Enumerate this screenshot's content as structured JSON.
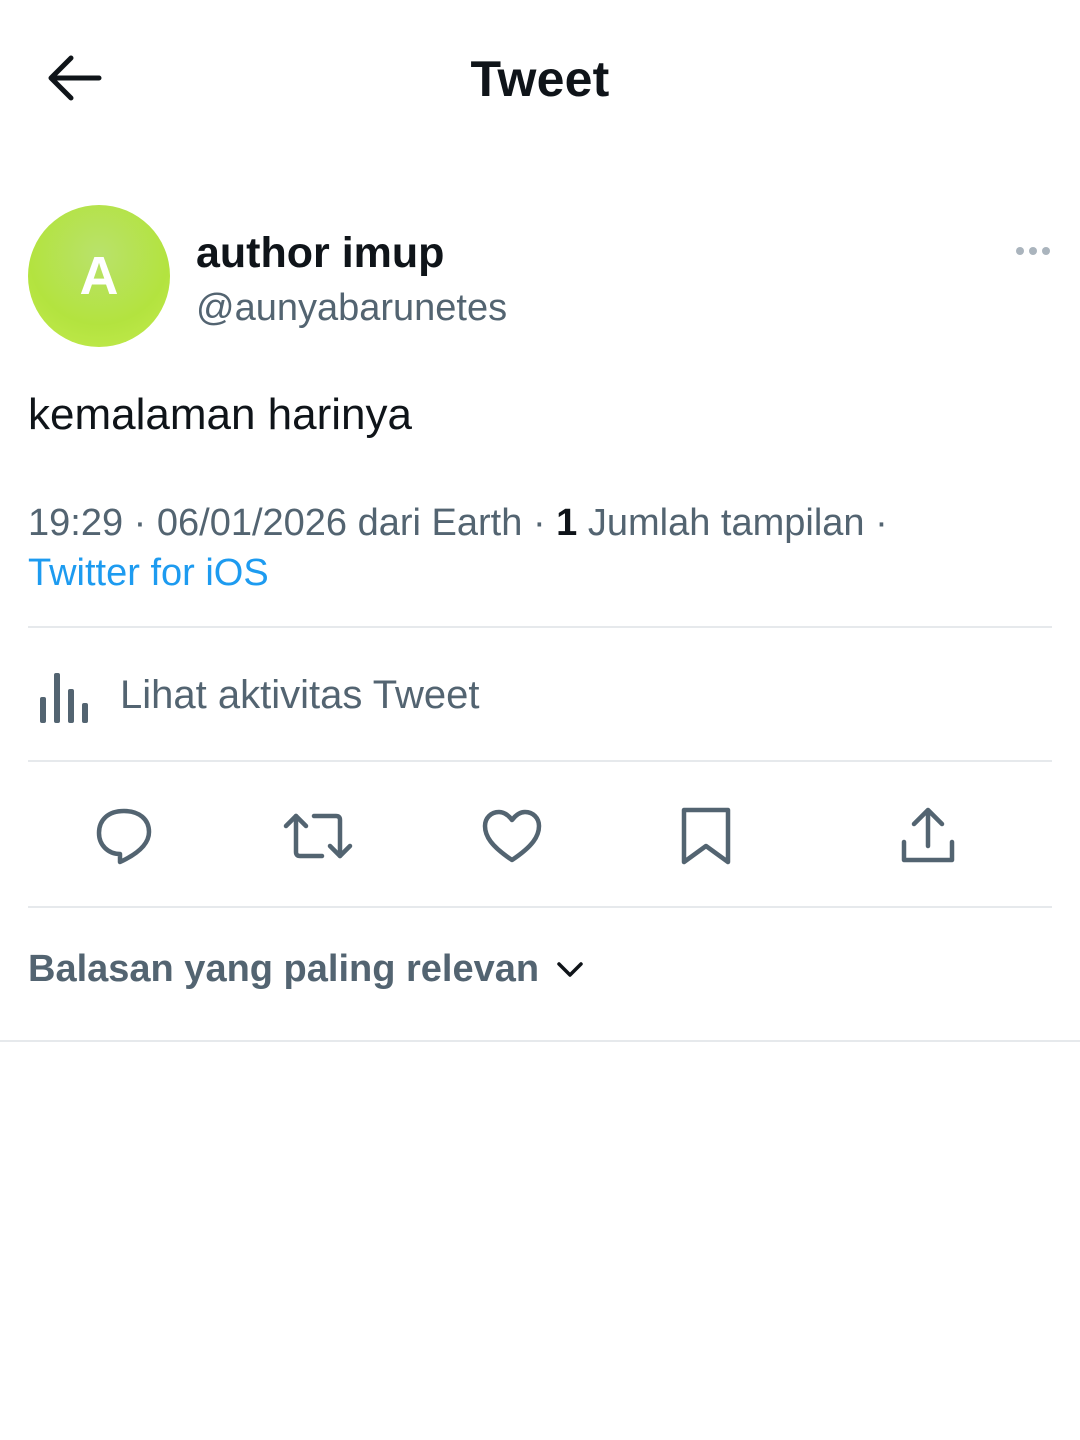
{
  "header": {
    "title": "Tweet",
    "back_icon": "arrow-left-icon"
  },
  "author": {
    "avatar_initial": "A",
    "avatar_color": "#b3e33f",
    "name": "author imup",
    "handle": "@aunyabarunetes"
  },
  "tweet": {
    "text": "kemalaman harinya"
  },
  "meta": {
    "time": "19:29",
    "date": "06/01/2026",
    "location_text": "dari Earth",
    "views_count": "1",
    "views_label": "Jumlah tampilan",
    "separator": "·",
    "source": "Twitter for iOS"
  },
  "activity": {
    "label": "Lihat aktivitas Tweet",
    "icon": "bar-chart-icon"
  },
  "actions": {
    "items": [
      "reply-icon",
      "retweet-icon",
      "like-icon",
      "bookmark-icon",
      "share-icon"
    ]
  },
  "replies": {
    "sort_label": "Balasan yang paling relevan"
  },
  "colors": {
    "accent": "#1d9bf0",
    "secondary_text": "#536471",
    "divider": "#e6e9ec"
  }
}
